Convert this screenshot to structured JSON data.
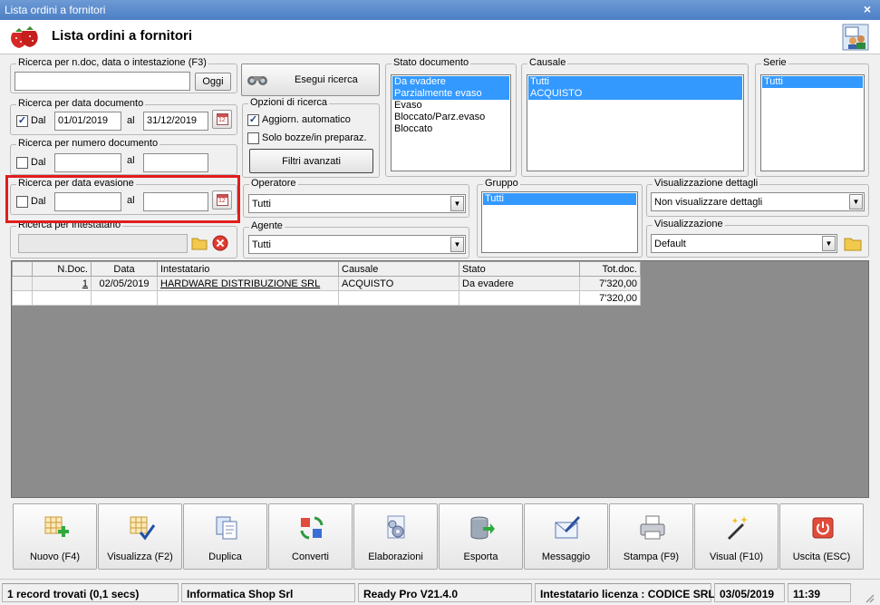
{
  "window": {
    "title": "Lista ordini a fornitori",
    "close": "×"
  },
  "header": {
    "title": "Lista ordini a fornitori"
  },
  "search_text": {
    "label": "Ricerca per n.doc, data o intestazione (F3)",
    "value": "",
    "today_btn": "Oggi"
  },
  "search_btn": "Esegui ricerca",
  "doc_date": {
    "label": "Ricerca per data documento",
    "dal": "Dal",
    "al": "al",
    "from": "01/01/2019",
    "to": "31/12/2019",
    "checked": true
  },
  "doc_number": {
    "label": "Ricerca per numero documento",
    "dal": "Dal",
    "al": "al",
    "from": "",
    "to": ""
  },
  "evasion_date": {
    "label": "Ricerca per data evasione",
    "dal": "Dal",
    "al": "al",
    "from": "",
    "to": ""
  },
  "owner": {
    "label": "Ricerca per intestatario",
    "value": ""
  },
  "options": {
    "label": "Opzioni di ricerca",
    "auto_update": "Aggiorn. automatico",
    "drafts": "Solo bozze/in preparaz.",
    "advanced": "Filtri avanzati"
  },
  "stato": {
    "label": "Stato documento",
    "items": [
      "Da evadere",
      "Parzialmente evaso",
      "Evaso",
      "Bloccato/Parz.evaso",
      "Bloccato"
    ]
  },
  "causale": {
    "label": "Causale",
    "items": [
      "Tutti",
      "ACQUISTO"
    ]
  },
  "serie": {
    "label": "Serie",
    "items": [
      "Tutti"
    ]
  },
  "operatore": {
    "label": "Operatore",
    "value": "Tutti"
  },
  "agente": {
    "label": "Agente",
    "value": "Tutti"
  },
  "gruppo": {
    "label": "Gruppo",
    "items": [
      "Tutti"
    ]
  },
  "vis_dettagli": {
    "label": "Visualizzazione dettagli",
    "value": "Non visualizzare dettagli"
  },
  "visualizzazione": {
    "label": "Visualizzazione",
    "value": "Default"
  },
  "table": {
    "headers": [
      "N.Doc.",
      "Data",
      "Intestatario",
      "Causale",
      "Stato",
      "Tot.doc."
    ],
    "rows": [
      {
        "ndoc": "1",
        "data": "02/05/2019",
        "intestatario": "HARDWARE DISTRIBUZIONE SRL",
        "causale": "ACQUISTO",
        "stato": "Da evadere",
        "tot": "7'320,00"
      }
    ],
    "total": "7'320,00"
  },
  "toolbar": [
    "Nuovo (F4)",
    "Visualizza (F2)",
    "Duplica",
    "Converti",
    "Elaborazioni",
    "Esporta",
    "Messaggio",
    "Stampa (F9)",
    "Visual (F10)",
    "Uscita (ESC)"
  ],
  "status": {
    "records": "1 record trovati (0,1 secs)",
    "company": "Informatica Shop Srl",
    "version": "Ready Pro V21.4.0",
    "license": "Intestatario licenza : CODICE SRL",
    "date": "03/05/2019",
    "time": "11:39"
  },
  "colors": {
    "selection": "#3399ff",
    "highlight": "#e11d1d",
    "grid_bg": "#8c8c8c"
  }
}
